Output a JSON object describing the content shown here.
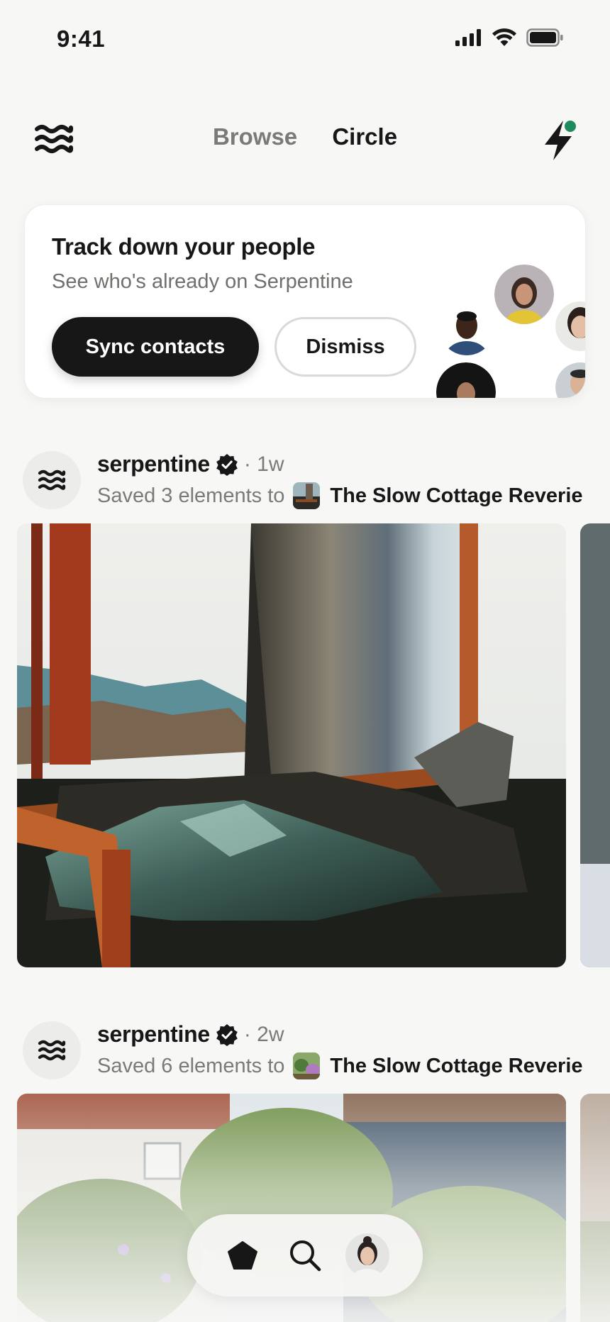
{
  "status_bar": {
    "time": "9:41"
  },
  "header": {
    "tabs": [
      {
        "label": "Browse",
        "active": false
      },
      {
        "label": "Circle",
        "active": true
      }
    ],
    "notification_dot_color": "#1f8a5b"
  },
  "track_card": {
    "title": "Track down your people",
    "subtitle": "See who's already on Serpentine",
    "sync_label": "Sync contacts",
    "dismiss_label": "Dismiss"
  },
  "posts": [
    {
      "user": "serpentine",
      "time": "· 1w",
      "meta": "Saved 3 elements to",
      "board": "The Slow Cottage Reverie"
    },
    {
      "user": "serpentine",
      "time": "· 2w",
      "meta": "Saved 6 elements to",
      "board": "The Slow Cottage Reverie"
    }
  ],
  "bottom_nav": {
    "items": [
      "home-icon",
      "search-icon",
      "profile-avatar"
    ]
  },
  "colors": {
    "background": "#f7f7f6",
    "primary_button": "#171717",
    "accent_green": "#1f8a5b",
    "muted_text": "#7a7a76"
  }
}
